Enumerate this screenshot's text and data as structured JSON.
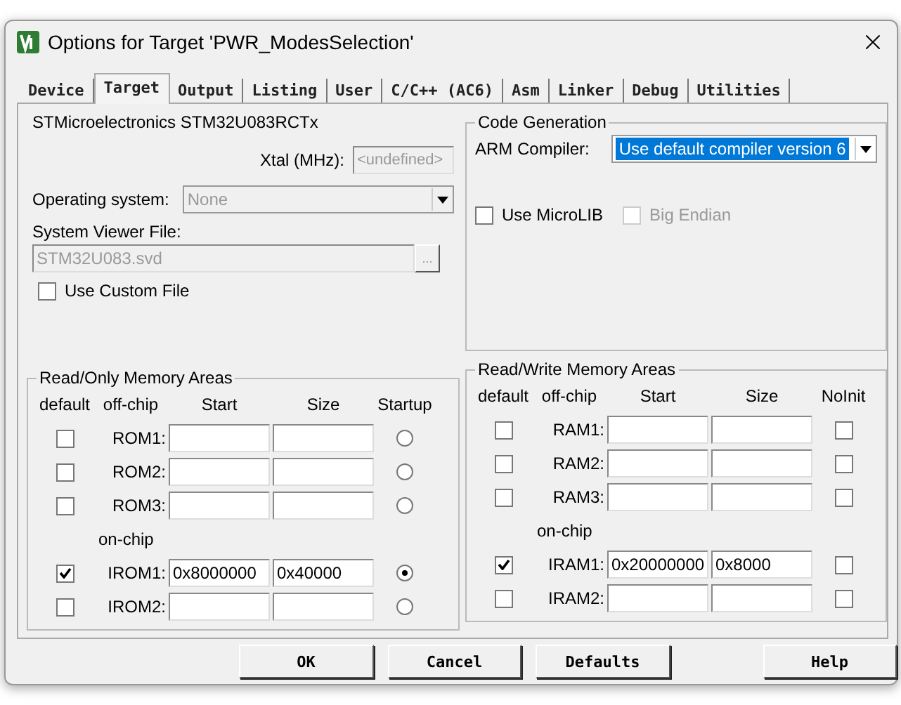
{
  "window": {
    "title": "Options for Target 'PWR_ModesSelection'"
  },
  "tabs": [
    {
      "label": "Device",
      "selected": false
    },
    {
      "label": "Target",
      "selected": true
    },
    {
      "label": "Output",
      "selected": false
    },
    {
      "label": "Listing",
      "selected": false
    },
    {
      "label": "User",
      "selected": false
    },
    {
      "label": "C/C++ (AC6)",
      "selected": false
    },
    {
      "label": "Asm",
      "selected": false
    },
    {
      "label": "Linker",
      "selected": false
    },
    {
      "label": "Debug",
      "selected": false
    },
    {
      "label": "Utilities",
      "selected": false
    }
  ],
  "device": {
    "name": "STMicroelectronics STM32U083RCTx",
    "xtal_label": "Xtal (MHz):",
    "xtal_value": "<undefined>",
    "xtal_disabled": true,
    "os_label": "Operating system:",
    "os_value": "None",
    "os_disabled": true,
    "svf_label": "System Viewer File:",
    "svf_value": "STM32U083.svd",
    "svf_disabled": true,
    "browse": "...",
    "custom_file": {
      "label": "Use Custom File",
      "checked": false
    }
  },
  "code_generation": {
    "title": "Code Generation",
    "compiler_label": "ARM Compiler:",
    "compiler_value": "Use default compiler version 6",
    "options": [
      {
        "label": "Use MicroLIB",
        "checked": false,
        "disabled": false
      },
      {
        "label": "Big Endian",
        "checked": false,
        "disabled": true
      }
    ]
  },
  "read_only": {
    "title": "Read/Only Memory Areas",
    "columns": [
      "default",
      "off-chip",
      "Start",
      "Size",
      "Startup"
    ],
    "on_chip_label": "on-chip",
    "off_chip": [
      {
        "label": "ROM1:",
        "checked": false,
        "selected": false
      },
      {
        "label": "ROM2:",
        "checked": false,
        "selected": false
      },
      {
        "label": "ROM3:",
        "checked": false,
        "selected": false
      }
    ],
    "on_chip": [
      {
        "label": "IROM1:",
        "checked": true,
        "start": "0x8000000",
        "size": "0x40000",
        "selected": true
      },
      {
        "label": "IROM2:",
        "checked": false,
        "selected": false
      }
    ]
  },
  "read_write": {
    "title": "Read/Write Memory Areas",
    "columns": [
      "default",
      "off-chip",
      "Start",
      "Size",
      "NoInit"
    ],
    "on_chip_label": "on-chip",
    "off_chip": [
      {
        "label": "RAM1:",
        "checked": false,
        "noinit": false
      },
      {
        "label": "RAM2:",
        "checked": false,
        "noinit": false
      },
      {
        "label": "RAM3:",
        "checked": false,
        "noinit": false
      }
    ],
    "on_chip": [
      {
        "label": "IRAM1:",
        "checked": true,
        "start": "0x20000000",
        "size": "0x8000",
        "noinit": false
      },
      {
        "label": "IRAM2:",
        "checked": false,
        "noinit": false
      }
    ]
  },
  "buttons": [
    "OK",
    "Cancel",
    "Defaults"
  ],
  "help_button": "Help"
}
